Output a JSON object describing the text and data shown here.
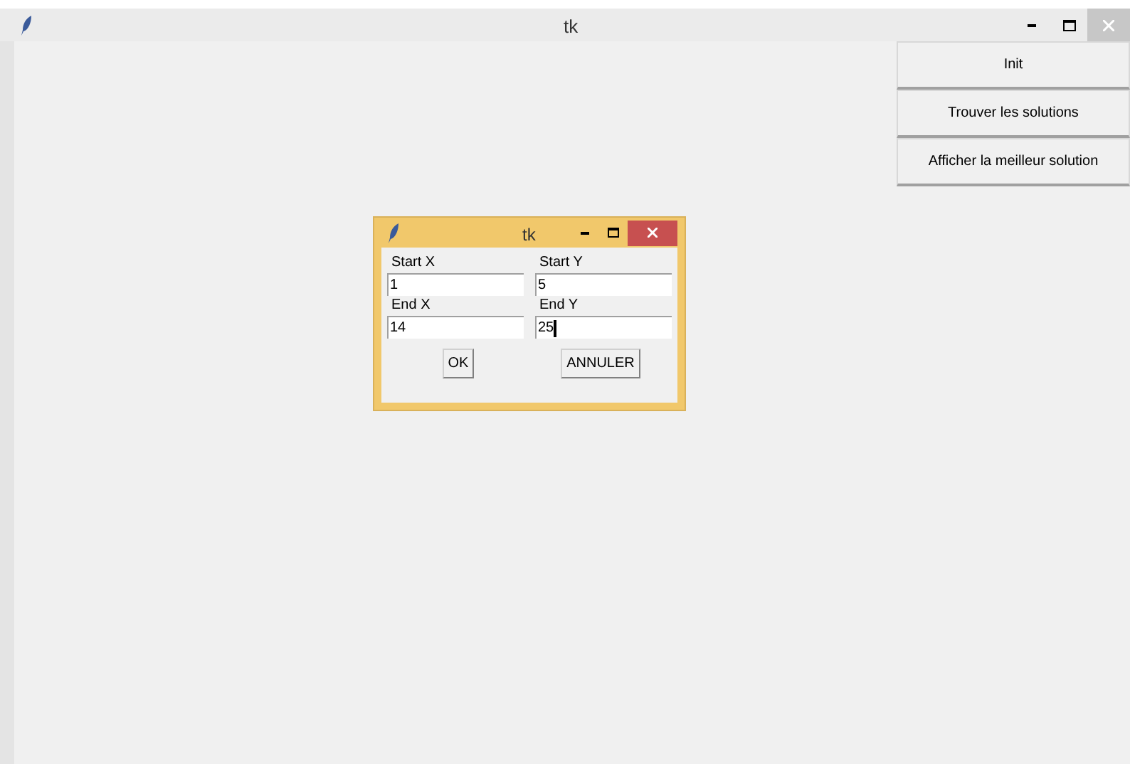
{
  "window": {
    "title": "tk"
  },
  "side_buttons": [
    "Init",
    "Trouver les solutions",
    "Afficher la meilleur solution"
  ],
  "dialog": {
    "title": "tk",
    "fields": [
      {
        "label": "Start X",
        "value": "1",
        "focused": false
      },
      {
        "label": "Start Y",
        "value": "5",
        "focused": false
      },
      {
        "label": "End X",
        "value": "14",
        "focused": false
      },
      {
        "label": "End Y",
        "value": "25",
        "focused": true
      }
    ],
    "buttons": [
      "OK",
      "ANNULER"
    ]
  }
}
